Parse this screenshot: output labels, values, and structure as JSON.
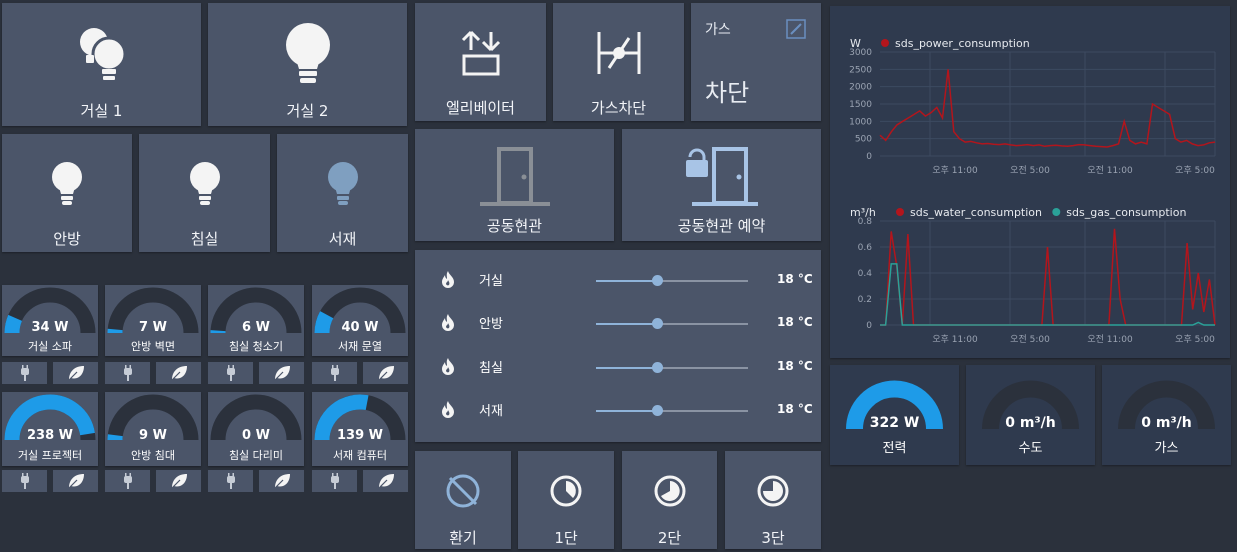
{
  "lights_top": [
    {
      "label": "거실 1",
      "icon": "double-bulb-icon"
    },
    {
      "label": "거실 2",
      "icon": "bulb-icon"
    }
  ],
  "lights_mid": [
    {
      "label": "안방",
      "icon": "bulb-icon",
      "state": "on"
    },
    {
      "label": "침실",
      "icon": "bulb-icon",
      "state": "on"
    },
    {
      "label": "서재",
      "icon": "bulb-icon",
      "state": "off"
    }
  ],
  "controls": {
    "elevator": {
      "label": "엘리베이터"
    },
    "gas_cut": {
      "label": "가스차단"
    },
    "gas_status": {
      "title": "가스",
      "value": "차단"
    },
    "door": {
      "label": "공동현관"
    },
    "door_reserve": {
      "label": "공동현관 예약"
    }
  },
  "plugs": [
    {
      "name": "거실 소파",
      "watts": "34 W",
      "fraction": 0.13
    },
    {
      "name": "안방 벽면",
      "watts": "7 W",
      "fraction": 0.03
    },
    {
      "name": "침실 청소기",
      "watts": "6 W",
      "fraction": 0.02
    },
    {
      "name": "서재 문열",
      "watts": "40 W",
      "fraction": 0.16
    },
    {
      "name": "거실 프로젝터",
      "watts": "238 W",
      "fraction": 0.95
    },
    {
      "name": "안방 침대",
      "watts": "9 W",
      "fraction": 0.04
    },
    {
      "name": "침실 다리미",
      "watts": "0 W",
      "fraction": 0.0
    },
    {
      "name": "서재 컴퓨터",
      "watts": "139 W",
      "fraction": 0.56
    }
  ],
  "heating": [
    {
      "room": "거실",
      "temp": "18 °C",
      "level": 0.4
    },
    {
      "room": "안방",
      "temp": "18 °C",
      "level": 0.4
    },
    {
      "room": "침실",
      "temp": "18 °C",
      "level": 0.4
    },
    {
      "room": "서재",
      "temp": "18 °C",
      "level": 0.4
    }
  ],
  "fan": [
    {
      "label": "환기",
      "icon": "fan-off-icon"
    },
    {
      "label": "1단",
      "icon": "fan-speed-1-icon"
    },
    {
      "label": "2단",
      "icon": "fan-speed-2-icon"
    },
    {
      "label": "3단",
      "icon": "fan-speed-3-icon"
    }
  ],
  "meters": [
    {
      "name": "전력",
      "value": "322 W",
      "fraction": 1.0
    },
    {
      "name": "수도",
      "value": "0 m³/h",
      "fraction": 0.0
    },
    {
      "name": "가스",
      "value": "0 m³/h",
      "fraction": 0.0
    }
  ],
  "colors": {
    "accent": "#1e9be8",
    "gauge_bg": "#2b313c",
    "card": "#4b5569",
    "panel": "#2f3a4e",
    "series_red": "#b3151c",
    "series_teal": "#2aa198",
    "light_off": "#7f9fc0"
  },
  "chart_data": [
    {
      "type": "line",
      "ylabel": "W",
      "ylim": [
        0,
        3000
      ],
      "yticks": [
        "3000",
        "2500",
        "2000",
        "1500",
        "1000",
        "500",
        "0"
      ],
      "xticks": [
        "오후 11:00",
        "오전 5:00",
        "오전 11:00",
        "오후 5:00"
      ],
      "series": [
        {
          "name": "sds_power_consumption",
          "values": [
            600,
            450,
            700,
            900,
            1000,
            1100,
            1200,
            1300,
            1150,
            1250,
            1400,
            1100,
            2500,
            700,
            500,
            400,
            420,
            380,
            350,
            360,
            340,
            330,
            350,
            320,
            300,
            310,
            330,
            300,
            320,
            280,
            300,
            310,
            290,
            280,
            300,
            330,
            320,
            300,
            280,
            270,
            260,
            300,
            350,
            1000,
            450,
            350,
            400,
            350,
            1500,
            1400,
            1300,
            1200,
            500,
            400,
            450,
            350,
            300,
            320,
            380,
            400
          ]
        }
      ]
    },
    {
      "type": "line",
      "ylabel": "m³/h",
      "ylim": [
        0,
        0.8
      ],
      "yticks": [
        "0.8",
        "0.6",
        "0.4",
        "0.2",
        "0"
      ],
      "xticks": [
        "오후 11:00",
        "오전 5:00",
        "오전 11:00",
        "오후 5:00"
      ],
      "series": [
        {
          "name": "sds_water_consumption",
          "values": [
            0,
            0,
            0.72,
            0.45,
            0,
            0.7,
            0,
            0,
            0,
            0,
            0,
            0,
            0,
            0,
            0,
            0,
            0,
            0,
            0,
            0,
            0,
            0,
            0,
            0,
            0,
            0,
            0,
            0,
            0,
            0,
            0.6,
            0,
            0,
            0,
            0,
            0,
            0,
            0,
            0,
            0,
            0,
            0,
            0.74,
            0.2,
            0,
            0,
            0,
            0,
            0,
            0,
            0,
            0,
            0,
            0,
            0,
            0.63,
            0.12,
            0.4,
            0.1,
            0.35,
            0
          ]
        },
        {
          "name": "sds_gas_consumption",
          "values": [
            0,
            0,
            0.47,
            0.47,
            0,
            0,
            0,
            0,
            0,
            0,
            0,
            0,
            0,
            0,
            0,
            0,
            0,
            0,
            0,
            0,
            0,
            0,
            0,
            0,
            0,
            0,
            0,
            0,
            0,
            0,
            0,
            0,
            0,
            0,
            0,
            0,
            0,
            0,
            0,
            0,
            0,
            0,
            0,
            0,
            0,
            0,
            0,
            0,
            0,
            0,
            0,
            0,
            0,
            0,
            0,
            0,
            0,
            0.02,
            0,
            0,
            0
          ]
        }
      ]
    }
  ]
}
